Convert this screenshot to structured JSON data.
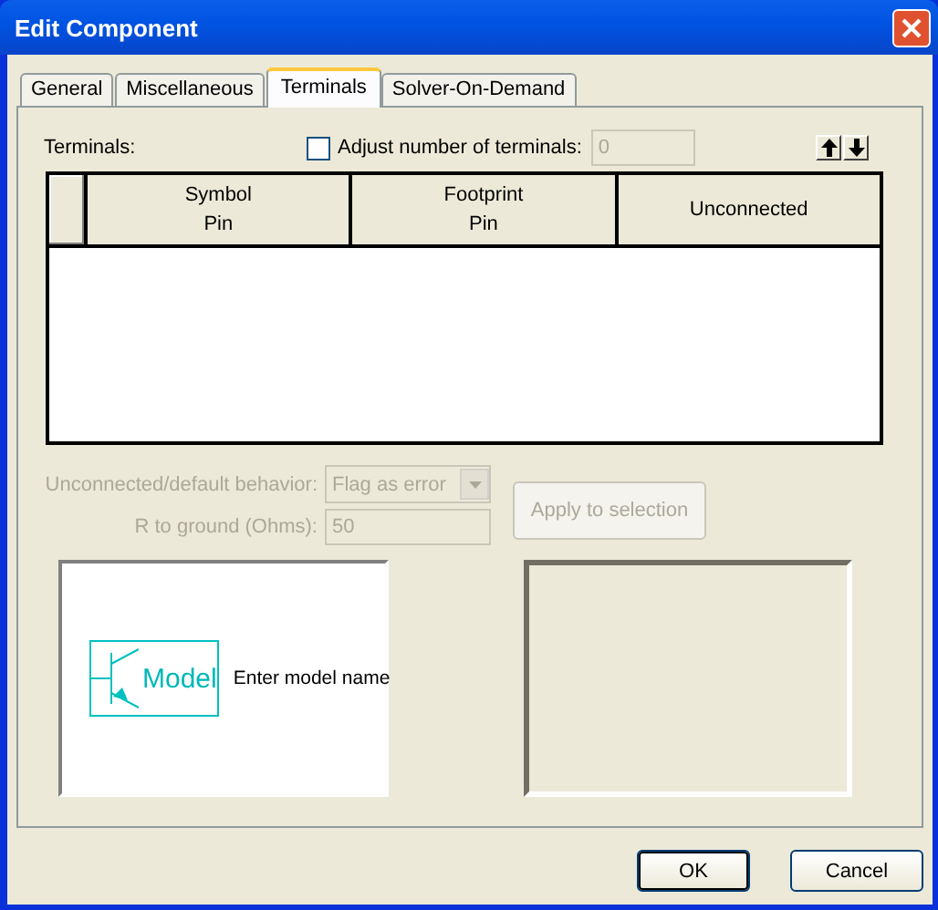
{
  "window": {
    "title": "Edit Component"
  },
  "tabs": [
    {
      "label": "General",
      "selected": false
    },
    {
      "label": "Miscellaneous",
      "selected": false
    },
    {
      "label": "Terminals",
      "selected": true
    },
    {
      "label": "Solver-On-Demand",
      "selected": false
    }
  ],
  "terminals": {
    "label": "Terminals:",
    "adjust_checkbox": {
      "label": "Adjust number of terminals:",
      "checked": false
    },
    "count_field": {
      "value": "0",
      "disabled": true
    }
  },
  "grid": {
    "columns": [
      {
        "lines": [
          "Symbol",
          "Pin"
        ]
      },
      {
        "lines": [
          "Footprint",
          "Pin"
        ]
      },
      {
        "lines": [
          "Unconnected"
        ]
      }
    ]
  },
  "behavior": {
    "label": "Unconnected/default behavior:",
    "value": "Flag as error",
    "disabled": true
  },
  "resistance": {
    "label": "R to ground (Ohms):",
    "value": "50",
    "disabled": true
  },
  "apply_button": {
    "label": "Apply to selection",
    "disabled": true
  },
  "model_preview": {
    "symbol_label": "Model",
    "caption": "Enter model name"
  },
  "buttons": [
    {
      "label": "OK",
      "default": true
    },
    {
      "label": "Cancel",
      "default": false
    }
  ]
}
